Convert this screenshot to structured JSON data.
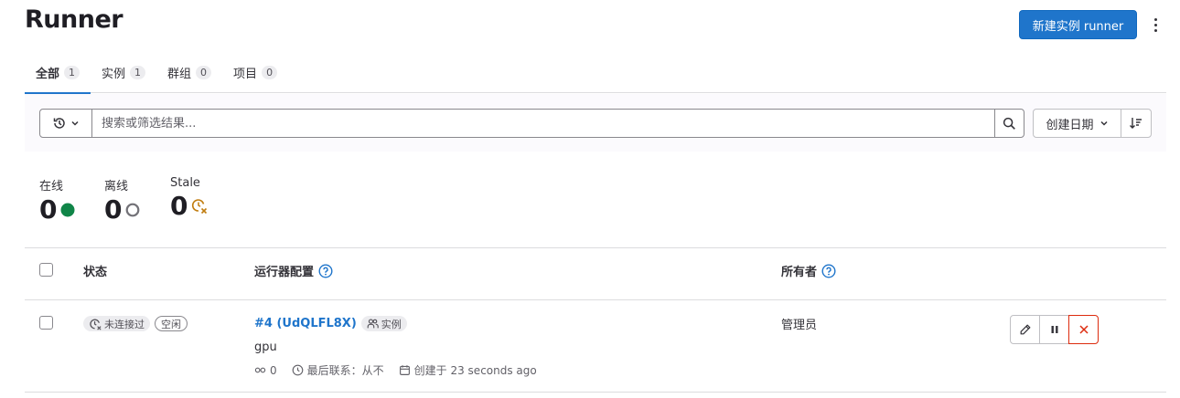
{
  "header": {
    "title": "Runner",
    "new_button": "新建实例 runner"
  },
  "tabs": [
    {
      "label": "全部",
      "count": "1"
    },
    {
      "label": "实例",
      "count": "1"
    },
    {
      "label": "群组",
      "count": "0"
    },
    {
      "label": "项目",
      "count": "0"
    }
  ],
  "filter": {
    "placeholder": "搜索或筛选结果...",
    "sort_label": "创建日期"
  },
  "stats": [
    {
      "label": "在线",
      "value": "0",
      "icon": "online-dot"
    },
    {
      "label": "离线",
      "value": "0",
      "icon": "offline-ring"
    },
    {
      "label": "Stale",
      "value": "0",
      "icon": "stale-clock"
    }
  ],
  "table": {
    "headers": {
      "status": "状态",
      "config": "运行器配置",
      "owner": "所有者"
    },
    "rows": [
      {
        "status_badge": "未连接过",
        "idle_badge": "空闲",
        "runner_link": "#4 (UdQLFL8X)",
        "type_badge": "实例",
        "description": "gpu",
        "jobs": "0",
        "last_contact": "最后联系：从不",
        "created": "创建于 23 seconds ago",
        "owner": "管理员"
      }
    ]
  },
  "colors": {
    "accent": "#1f75cb",
    "online": "#108548",
    "stale": "#c17d10",
    "danger": "#dd2b0e"
  }
}
